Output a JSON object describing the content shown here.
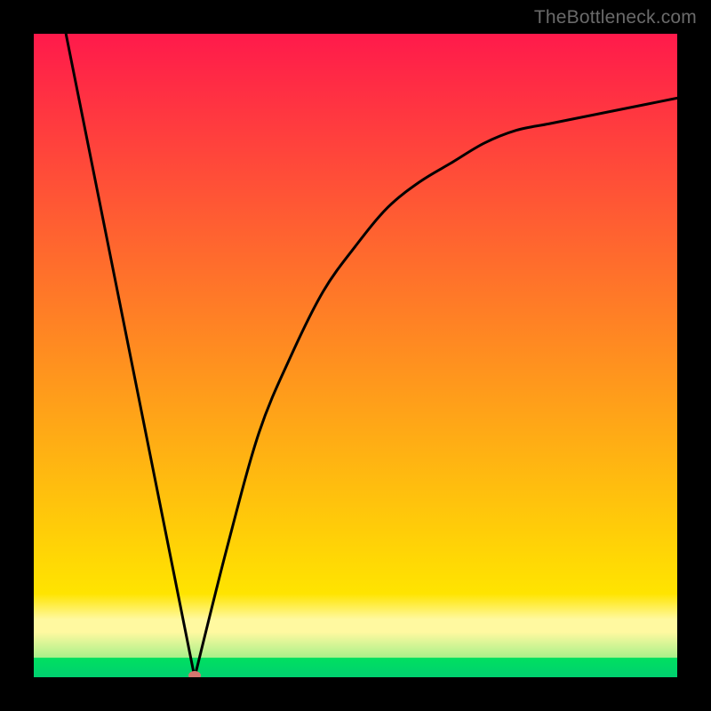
{
  "watermark": "TheBottleneck.com",
  "chart_data": {
    "type": "line",
    "title": "",
    "xlabel": "",
    "ylabel": "",
    "ylim": [
      0,
      100
    ],
    "xlim": [
      0,
      100
    ],
    "series": [
      {
        "name": "curve",
        "points": [
          {
            "x": 5,
            "y": 100
          },
          {
            "x": 25,
            "y": 0
          },
          {
            "x": 30,
            "y": 20
          },
          {
            "x": 35,
            "y": 38
          },
          {
            "x": 40,
            "y": 50
          },
          {
            "x": 45,
            "y": 60
          },
          {
            "x": 50,
            "y": 67
          },
          {
            "x": 55,
            "y": 73
          },
          {
            "x": 60,
            "y": 77
          },
          {
            "x": 65,
            "y": 80
          },
          {
            "x": 70,
            "y": 83
          },
          {
            "x": 75,
            "y": 85
          },
          {
            "x": 80,
            "y": 86
          },
          {
            "x": 85,
            "y": 87
          },
          {
            "x": 90,
            "y": 88
          },
          {
            "x": 95,
            "y": 89
          },
          {
            "x": 100,
            "y": 90
          }
        ],
        "minimum_marker": {
          "x": 25,
          "y": 0
        }
      }
    ],
    "gradient_bands": [
      {
        "y0": 100,
        "y1": 13,
        "from": "#ff1a4b",
        "to": "#ffe400"
      },
      {
        "y0": 13,
        "y1": 9,
        "from": "#ffe400",
        "to": "#fff9a0"
      },
      {
        "y0": 9,
        "y1": 7,
        "from": "#fff9a0",
        "to": "#fff9a0"
      },
      {
        "y0": 7,
        "y1": 3,
        "from": "#fff9a0",
        "to": "#a8f08a"
      },
      {
        "y0": 3,
        "y1": 0,
        "from": "#00e060",
        "to": "#00d070"
      }
    ]
  }
}
